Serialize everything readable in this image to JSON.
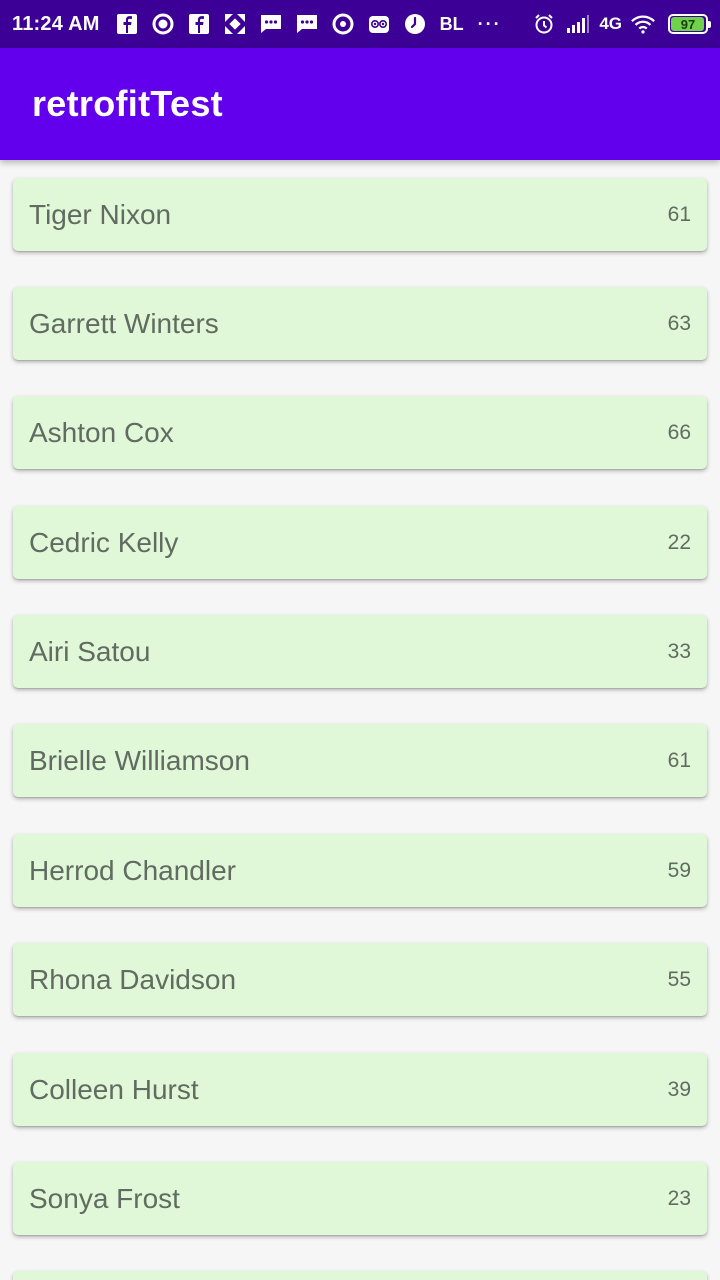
{
  "status_bar": {
    "time": "11:24 AM",
    "carrier_text": "BL",
    "more_dots": "···",
    "network": "4G",
    "battery": "97",
    "battery_level": 0.97,
    "icons": [
      "facebook-icon",
      "circle-icon",
      "facebook-icon",
      "grid-app-icon",
      "message-icon",
      "message-icon",
      "target-icon",
      "owl-icon",
      "clock-icon",
      "alarm-icon",
      "signal-icon",
      "wifi-icon",
      "battery-icon"
    ]
  },
  "app_bar": {
    "title": "retrofitTest"
  },
  "employees": [
    {
      "name": "Tiger Nixon",
      "age": "61"
    },
    {
      "name": "Garrett Winters",
      "age": "63"
    },
    {
      "name": "Ashton Cox",
      "age": "66"
    },
    {
      "name": "Cedric Kelly",
      "age": "22"
    },
    {
      "name": "Airi Satou",
      "age": "33"
    },
    {
      "name": "Brielle Williamson",
      "age": "61"
    },
    {
      "name": "Herrod Chandler",
      "age": "59"
    },
    {
      "name": "Rhona Davidson",
      "age": "55"
    },
    {
      "name": "Colleen Hurst",
      "age": "39"
    },
    {
      "name": "Sonya Frost",
      "age": "23"
    },
    {
      "name": "",
      "age": ""
    }
  ],
  "colors": {
    "status_bar": "#3c0096",
    "app_bar": "#6200ee",
    "card_background": "#e0f8d8",
    "page_background": "#f6f6f6",
    "text": "#616b61"
  }
}
